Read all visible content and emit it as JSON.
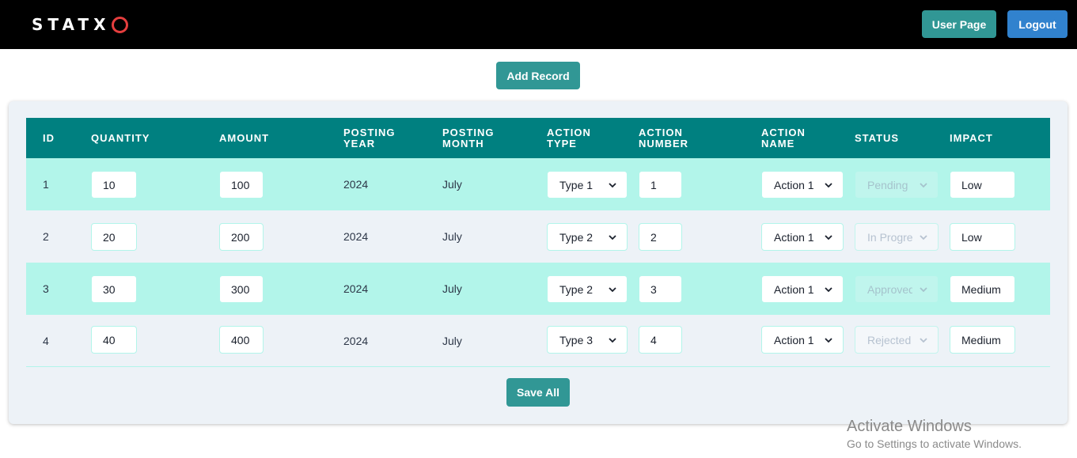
{
  "header": {
    "logo_text": "STATX",
    "user_page_label": "User Page",
    "logout_label": "Logout"
  },
  "toolbar": {
    "add_record_label": "Add Record"
  },
  "table": {
    "columns": [
      "ID",
      "QUANTITY",
      "AMOUNT",
      "POSTING YEAR",
      "POSTING MONTH",
      "ACTION TYPE",
      "ACTION NUMBER",
      "ACTION NAME",
      "STATUS",
      "IMPACT"
    ],
    "rows": [
      {
        "id": "1",
        "quantity": "10",
        "amount": "100",
        "posting_year": "2024",
        "posting_month": "July",
        "action_type": "Type 1",
        "action_number": "1",
        "action_name": "Action 1",
        "status": "Pending",
        "impact": "Low"
      },
      {
        "id": "2",
        "quantity": "20",
        "amount": "200",
        "posting_year": "2024",
        "posting_month": "July",
        "action_type": "Type 2",
        "action_number": "2",
        "action_name": "Action 1",
        "status": "In Progress",
        "impact": "Low"
      },
      {
        "id": "3",
        "quantity": "30",
        "amount": "300",
        "posting_year": "2024",
        "posting_month": "July",
        "action_type": "Type 2",
        "action_number": "3",
        "action_name": "Action 1",
        "status": "Approved",
        "impact": "Medium"
      },
      {
        "id": "4",
        "quantity": "40",
        "amount": "400",
        "posting_year": "2024",
        "posting_month": "July",
        "action_type": "Type 3",
        "action_number": "4",
        "action_name": "Action 1",
        "status": "Rejected",
        "impact": "Medium"
      }
    ]
  },
  "footer": {
    "save_all_label": "Save All"
  },
  "watermark": {
    "title": "Activate Windows",
    "subtitle": "Go to Settings to activate Windows."
  },
  "colors": {
    "header_bg": "#000000",
    "teal_button": "#319795",
    "blue_button": "#3182ce",
    "table_header": "#008080",
    "row_highlight": "#b2f5ea",
    "logo_ring": "#e53e3e"
  }
}
